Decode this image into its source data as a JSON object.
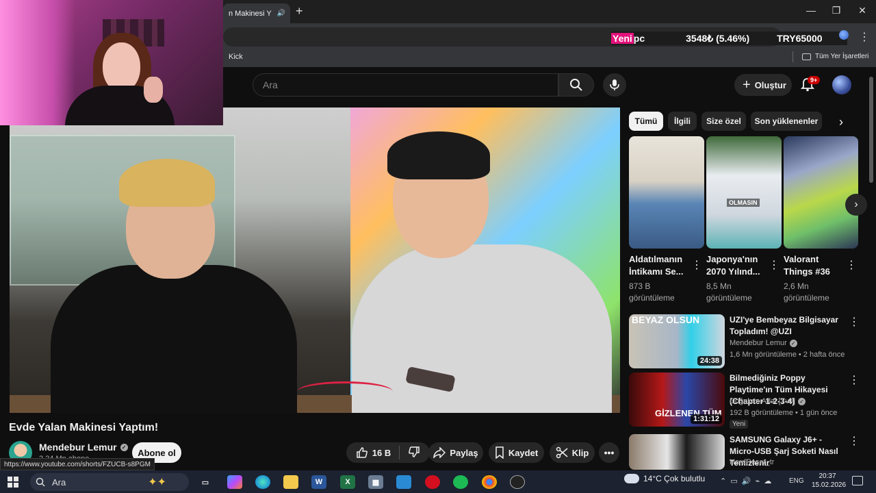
{
  "browser": {
    "tab_title": "n Makinesi Y",
    "newtab_label": "+",
    "minimize": "—",
    "maximize": "❐",
    "close": "✕",
    "tab_close": "✕"
  },
  "ticker": {
    "name_part1": "Yeni",
    "name_part2": " pc",
    "change": "3548₺ (5.46%)",
    "symbol": "TRY65000"
  },
  "bookmarks": {
    "item1": "Kick",
    "all_bookmarks": "Tüm Yer İşaretleri"
  },
  "youtube": {
    "search_placeholder": "Ara",
    "create_label": "Oluştur",
    "notifications_badge": "9+"
  },
  "video": {
    "title": "Evde Yalan Makinesi Yaptım!",
    "channel": "Mendebur Lemur",
    "subscribers": "2,24 Mn abone",
    "subscribe_label": "Abone ol",
    "likes": "16 B",
    "share_label": "Paylaş",
    "save_label": "Kaydet",
    "clip_label": "Klip",
    "status_url": "https://www.youtube.com/shorts/FZUCB-s8PGM"
  },
  "chips": [
    "Tümü",
    "İlgili",
    "Size özel",
    "Son yüklenenler"
  ],
  "shorts": [
    {
      "title": "Aldatılmanın İntikamı Se...",
      "views": "873 B görüntüleme"
    },
    {
      "title": "Japonya'nın 2070 Yılınd...",
      "views": "8,5 Mn görüntüleme",
      "overlay": "OLMASIN"
    },
    {
      "title": "Valorant Things #36",
      "views": "2,6 Mn görüntüleme"
    }
  ],
  "recommended": [
    {
      "title": "UZI'ye Bembeyaz Bilgisayar Topladım! @UZI",
      "channel": "Mendebur Lemur",
      "meta": "1,6 Mn görüntüleme • 2 hafta önce",
      "duration": "24:38",
      "thumb_text": "BEYAZ OLSUN"
    },
    {
      "title": "Bilmediğiniz Poppy Playtime'ın Tüm Hikayesi (Chapter 1-2-3-4)",
      "channel": "Doğukan Adal [Tvo]",
      "meta": "192 B görüntüleme • 1 gün önce",
      "duration": "1:31:12",
      "badge": "Yeni",
      "thumb_text": "GİZLENEN TÜM H"
    },
    {
      "title": "SAMSUNG Galaxy J6+ - Micro-USB Şarj Soketi Nasıl Temizlenir",
      "channel": "HardReset_tr"
    }
  ],
  "taskbar": {
    "search_label": "Ara",
    "weather": "14°C  Çok bulutlu",
    "language": "ENG",
    "time": "20:37",
    "date": "15.02.2026"
  }
}
